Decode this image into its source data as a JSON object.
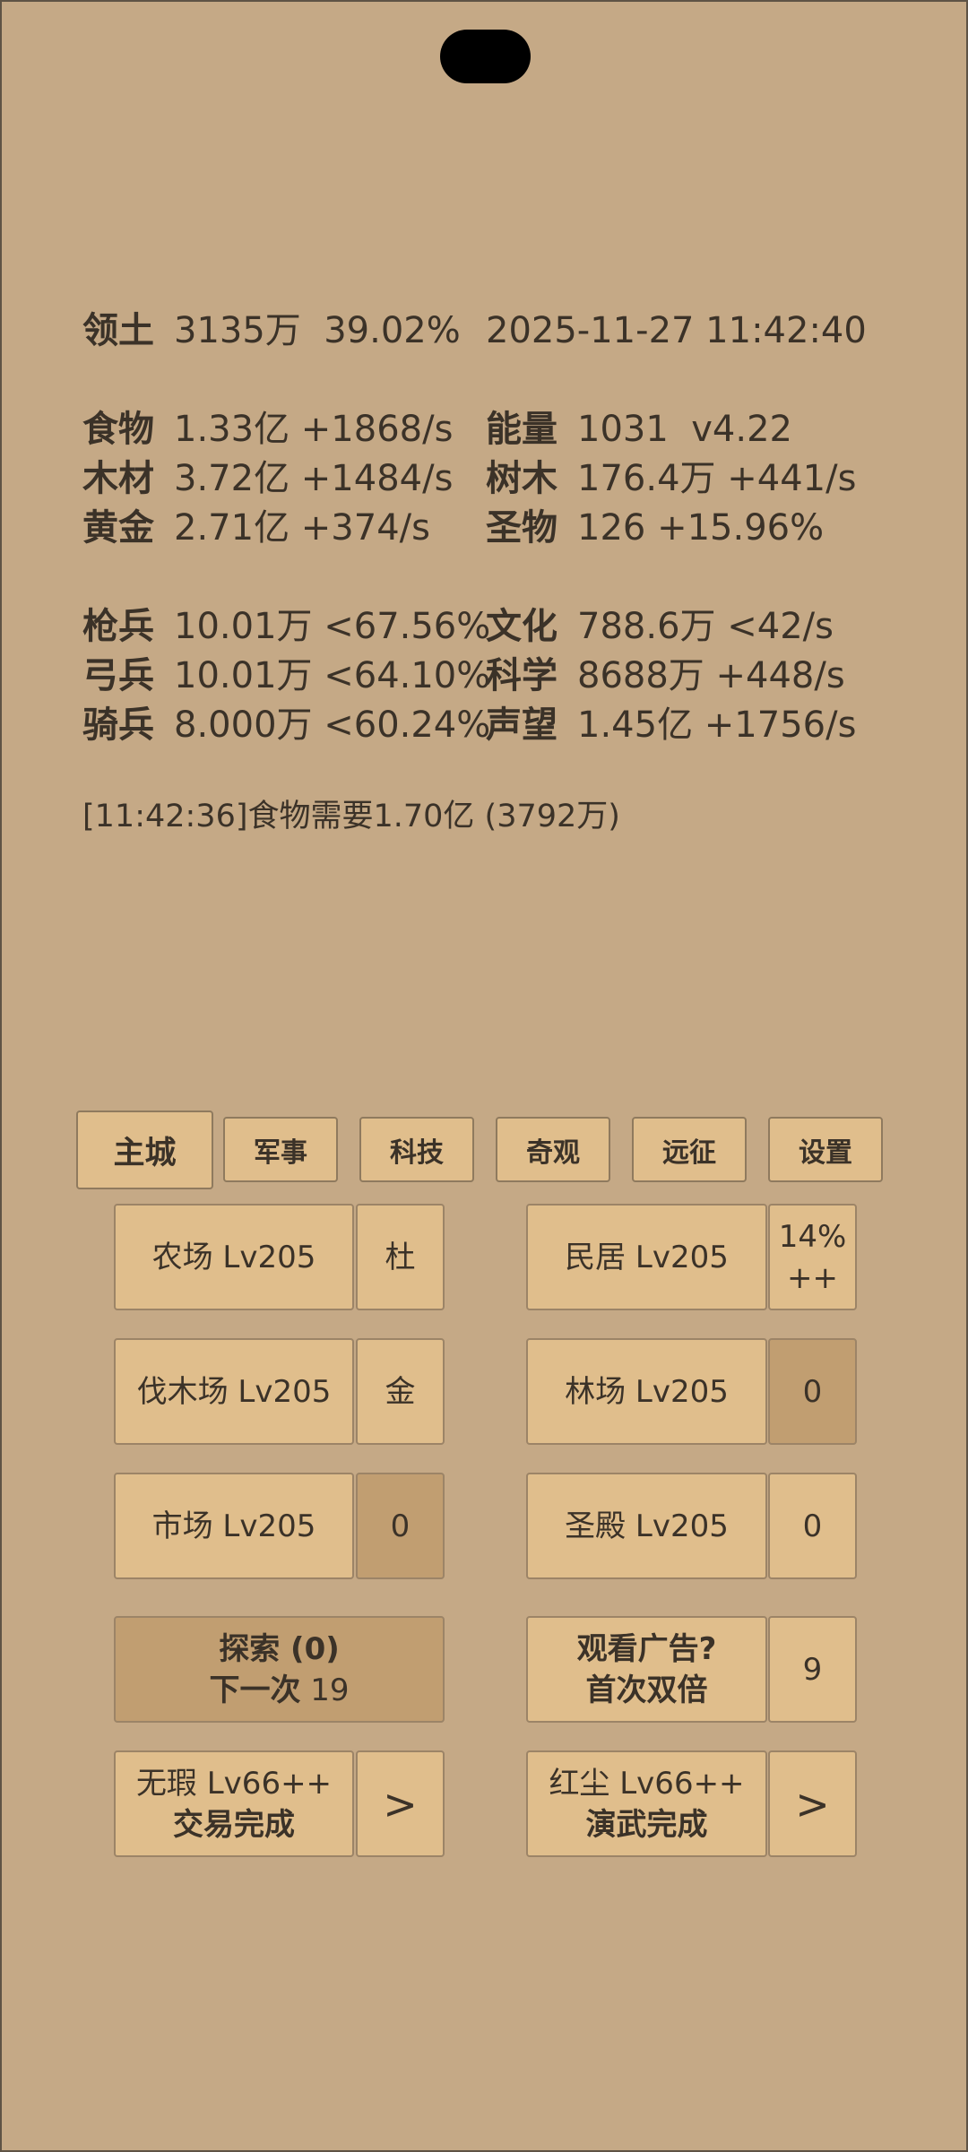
{
  "header": {
    "territory_label": "领土",
    "territory_value": "3135万  39.02%",
    "datetime": "2025-11-27 11:42:40"
  },
  "resources": [
    {
      "label": "食物",
      "value": "1.33亿 +1868/s"
    },
    {
      "label": "木材",
      "value": "3.72亿 +1484/s"
    },
    {
      "label": "黄金",
      "value": "2.71亿 +374/s"
    }
  ],
  "resources_right": [
    {
      "label": "能量",
      "value": "1031  v4.22"
    },
    {
      "label": "树木",
      "value": "176.4万 +441/s"
    },
    {
      "label": "圣物",
      "value": "126 +15.96%"
    }
  ],
  "military": [
    {
      "label": "枪兵",
      "value": "10.01万 <67.56%"
    },
    {
      "label": "弓兵",
      "value": "10.01万 <64.10%"
    },
    {
      "label": "骑兵",
      "value": "8.000万 <60.24%"
    }
  ],
  "culture": [
    {
      "label": "文化",
      "value": "788.6万 <42/s"
    },
    {
      "label": "科学",
      "value": "8688万 +448/s"
    },
    {
      "label": "声望",
      "value": "1.45亿 +1756/s"
    }
  ],
  "log": "[11:42:36]食物需要1.70亿 (3792万)",
  "tabs": [
    "主城",
    "军事",
    "科技",
    "奇观",
    "远征",
    "设置"
  ],
  "buildings": {
    "farm": "农场 Lv205",
    "farm_side": "杜",
    "house": "民居 Lv205",
    "house_side_1": "14%",
    "house_side_2": "++",
    "lumber": "伐木场 Lv205",
    "lumber_side": "金",
    "forest": "林场 Lv205",
    "forest_side": "0",
    "market": "市场 Lv205",
    "market_side": "0",
    "temple": "圣殿 Lv205",
    "temple_side": "0"
  },
  "explore": {
    "line1": "探索 (0)",
    "line2_prefix": "下一次",
    "line2_value": "19"
  },
  "ad": {
    "line1": "观看广告?",
    "line2": "首次双倍",
    "side": "9"
  },
  "flawless": {
    "line1": "无瑕 Lv66++",
    "line2": "交易完成",
    "side": ">"
  },
  "red_dust": {
    "line1": "红尘 Lv66++",
    "line2": "演武完成",
    "side": ">"
  }
}
